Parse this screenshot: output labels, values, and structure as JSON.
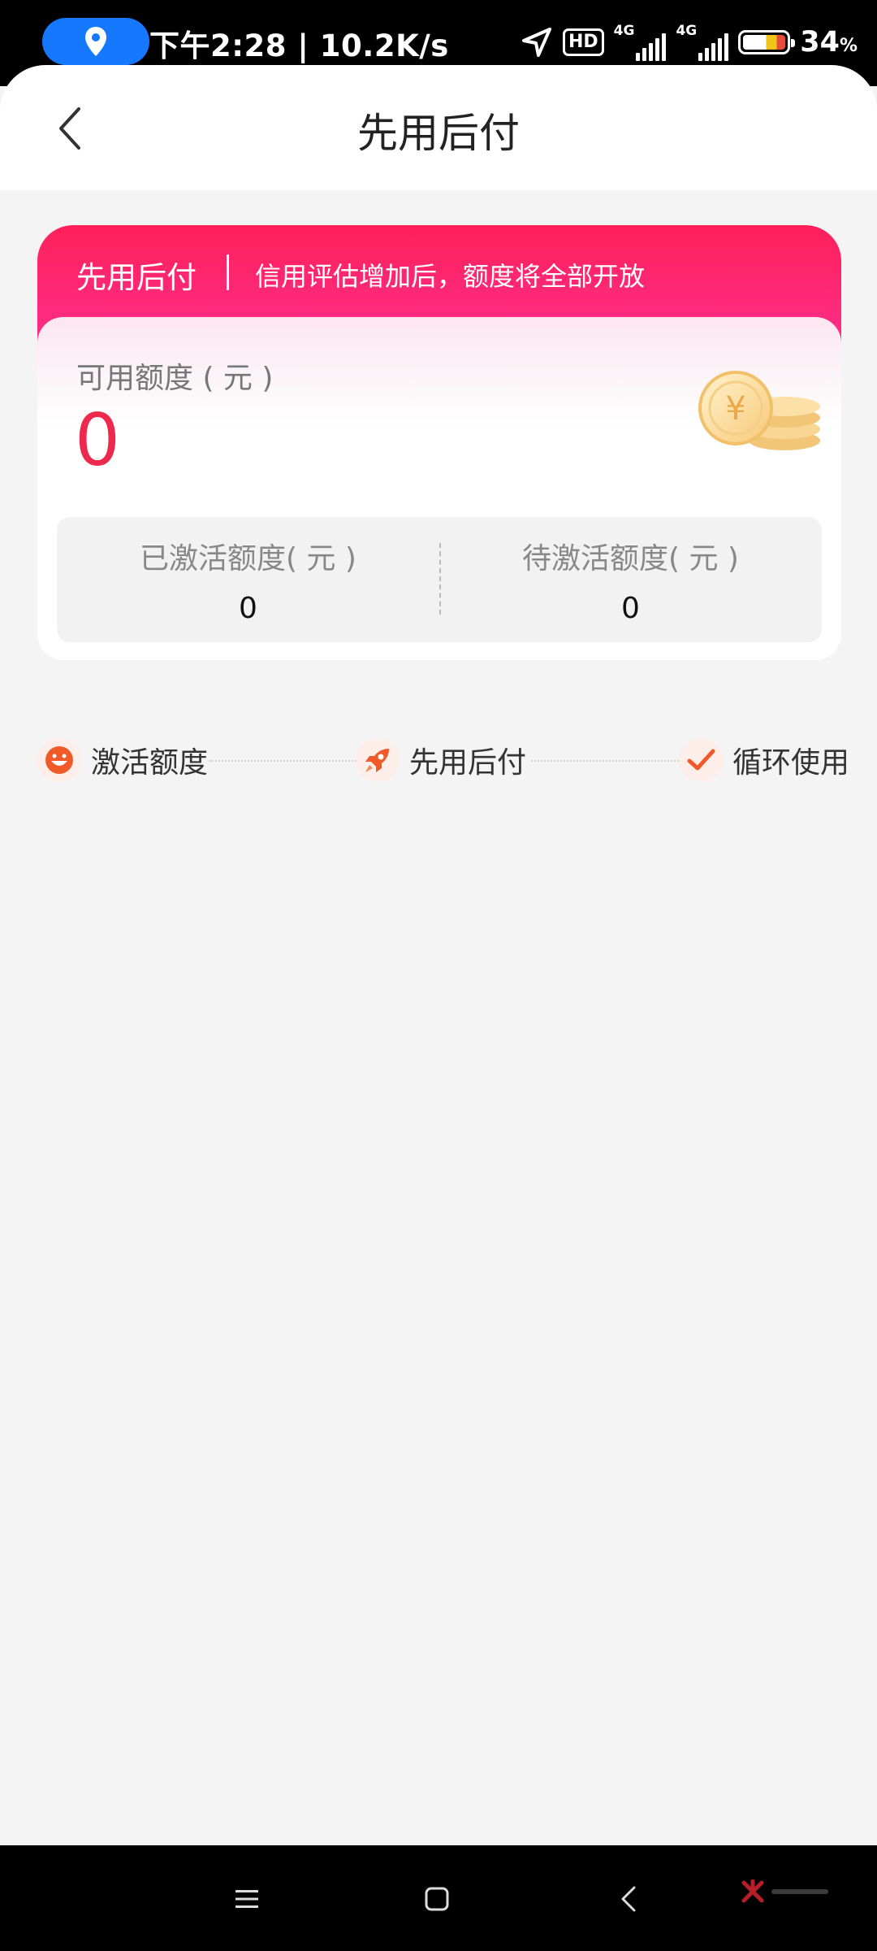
{
  "status_bar": {
    "time_speed": "下午2:28 | 10.2K/s",
    "hd_label": "HD",
    "net_label_1": "4G",
    "net_label_2": "4G",
    "battery_percent": "34",
    "battery_unit": "%"
  },
  "header": {
    "title": "先用后付"
  },
  "card": {
    "title": "先用后付",
    "description": "信用评估增加后，额度将全部开放",
    "available_label": "可用额度 ( 元 )",
    "available_value": "0",
    "activated_label": "已激活额度( 元 )",
    "activated_value": "0",
    "pending_label": "待激活额度( 元 )",
    "pending_value": "0"
  },
  "steps": [
    {
      "label": "激活额度",
      "icon": "smile-icon"
    },
    {
      "label": "先用后付",
      "icon": "rocket-icon"
    },
    {
      "label": "循环使用",
      "icon": "check-icon"
    }
  ],
  "colors": {
    "accent": "#fe2059",
    "value_red": "#ed2a4d",
    "step_icon": "#f05a28"
  }
}
